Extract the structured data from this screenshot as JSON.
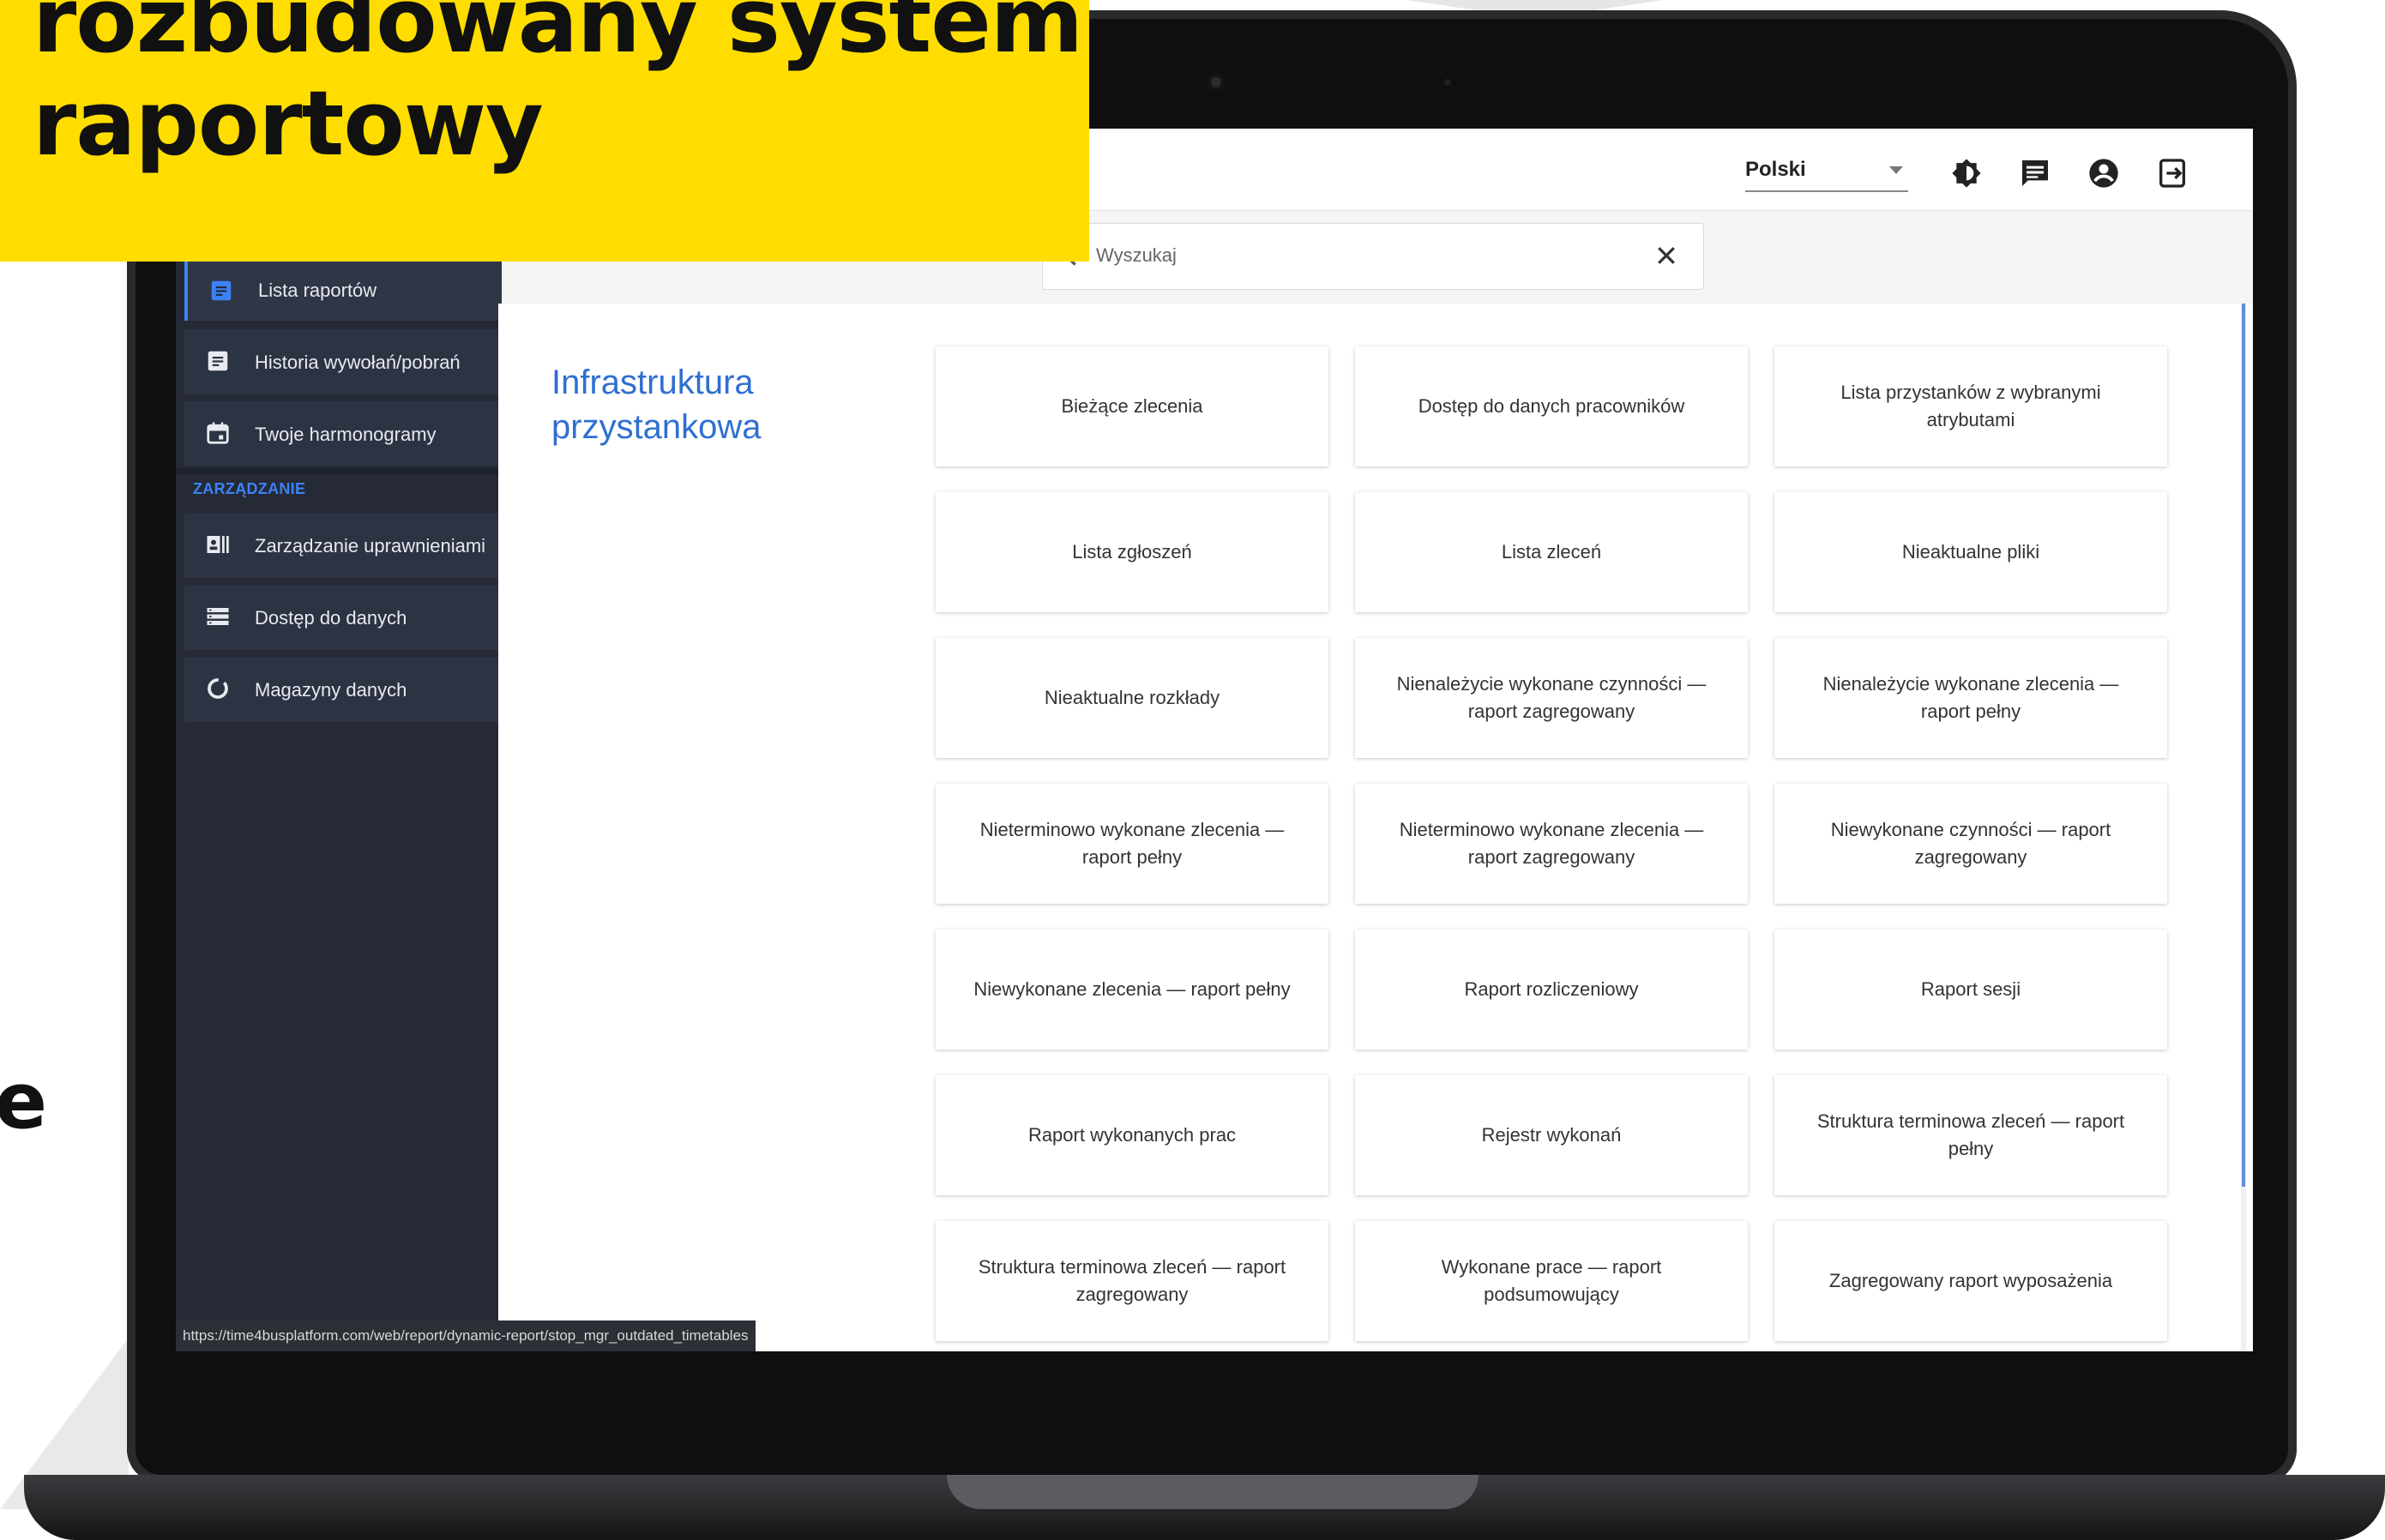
{
  "banner": {
    "line1": "rozbudowany system",
    "line2": "raportowy"
  },
  "stray_letter": "e",
  "topbar": {
    "language": "Polski",
    "icons": [
      "brightness-icon",
      "chat-icon",
      "account-icon",
      "logout-icon"
    ]
  },
  "search": {
    "placeholder": "Wyszukaj"
  },
  "sidebar": {
    "items": [
      {
        "label": "Lista raportów",
        "icon": "report-list-icon",
        "active": true
      },
      {
        "label": "Historia wywołań/pobrań",
        "icon": "history-icon",
        "active": false
      },
      {
        "label": "Twoje harmonogramy",
        "icon": "calendar-icon",
        "active": false
      }
    ],
    "section_label": "ZARZĄDZANIE",
    "management_items": [
      {
        "label": "Zarządzanie uprawnieniami",
        "icon": "permissions-icon"
      },
      {
        "label": "Dostęp do danych",
        "icon": "data-access-icon"
      },
      {
        "label": "Magazyny danych",
        "icon": "data-store-icon"
      }
    ]
  },
  "main": {
    "section_title": "Infrastruktura przystankowa",
    "cards": [
      "Bieżące zlecenia",
      "Dostęp do danych pracowników",
      "Lista przystanków z wybranymi atrybutami",
      "Lista zgłoszeń",
      "Lista zleceń",
      "Nieaktualne pliki",
      "Nieaktualne rozkłady",
      "Nienależycie wykonane czynności — raport zagregowany",
      "Nienależycie wykonane zlecenia — raport pełny",
      "Nieterminowo wykonane zlecenia — raport pełny",
      "Nieterminowo wykonane zlecenia — raport zagregowany",
      "Niewykonane czynności — raport zagregowany",
      "Niewykonane zlecenia — raport pełny",
      "Raport rozliczeniowy",
      "Raport sesji",
      "Raport wykonanych prac",
      "Rejestr wykonań",
      "Struktura terminowa zleceń — raport pełny",
      "Struktura terminowa zleceń — raport zagregowany",
      "Wykonane prace — raport podsumowujący",
      "Zagregowany raport wyposażenia"
    ]
  },
  "statusbar": {
    "url": "https://time4busplatform.com/web/report/dynamic-report/stop_mgr_outdated_timetables"
  },
  "colors": {
    "banner": "#ffdd00",
    "sidebar": "#252a36",
    "accent": "#3b82f6",
    "section_title": "#2f6fd1"
  }
}
